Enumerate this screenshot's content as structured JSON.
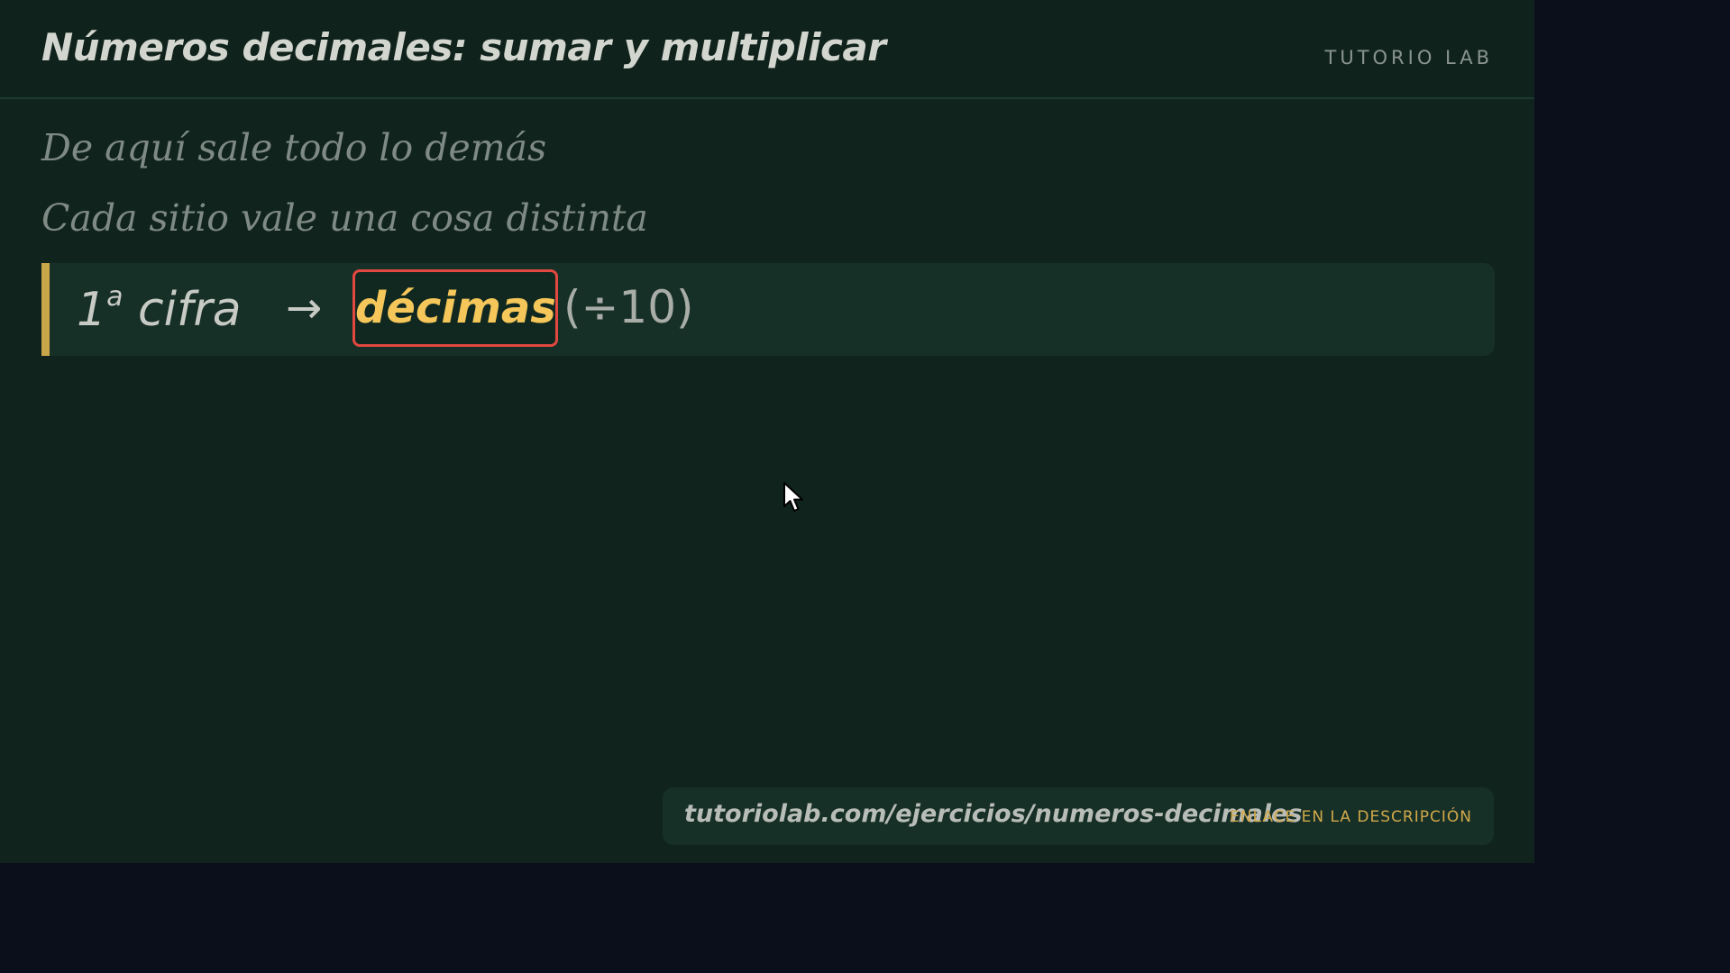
{
  "header": {
    "title": "Números decimales: sumar y multiplicar",
    "brand": "TUTORIO LAB"
  },
  "content": {
    "line1": "De aquí sale todo lo demás",
    "line2": "Cada sitio vale una cosa distinta",
    "formula": {
      "position_number": "1",
      "position_suffix": "a",
      "position_word": "cifra",
      "arrow": "→",
      "highlight": "décimas",
      "divisor": "(÷10)"
    }
  },
  "footer": {
    "url": "tutoriolab.com/ejercicios/numeros-decimales",
    "note": "ENLACE EN LA DESCRIPCIÓN"
  },
  "colors": {
    "board_bg": "#10241d",
    "outer_bg": "#0b0f1b",
    "accent_bar": "#c9a64a",
    "highlight_border": "#e2483f",
    "highlight_text": "#f5c65a"
  },
  "icons": {
    "cursor": "mouse-pointer-icon"
  }
}
